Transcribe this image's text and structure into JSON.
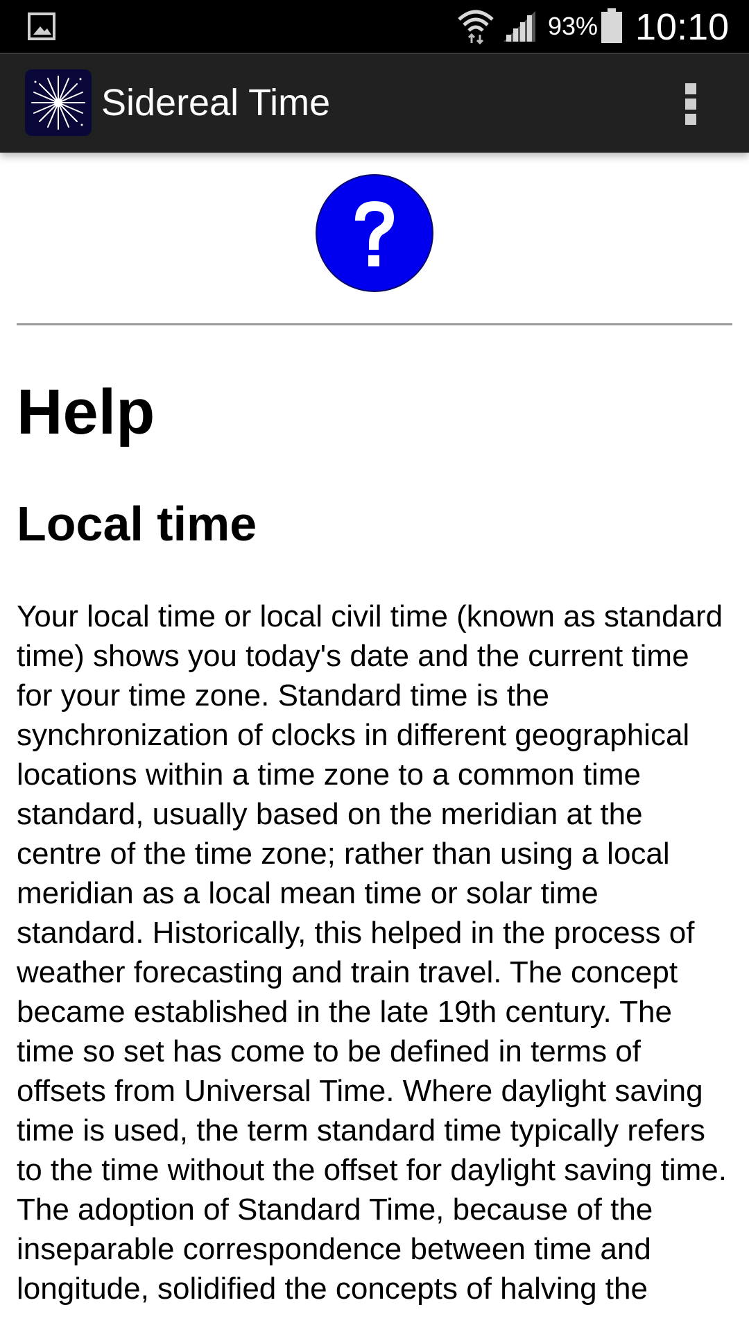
{
  "status_bar": {
    "notification_icon": "gallery-icon",
    "wifi_icon": "wifi-icon",
    "signal_icon": "signal-icon",
    "battery_percent": "93%",
    "battery_icon": "battery-icon",
    "time": "10:10"
  },
  "action_bar": {
    "app_icon": "starburst-app-icon",
    "title": "Sidereal Time",
    "menu_icon": "overflow-menu-icon"
  },
  "content": {
    "badge_icon": "help-question-icon",
    "page_title": "Help",
    "section_title": "Local time",
    "paragraph": "Your local time or local civil time (known as standard time) shows you today's date and the current time for your time zone. Standard time is the synchronization of clocks in different geographical locations within a time zone to a common time standard, usually based on the meridian at the centre of the time zone; rather than using a local meridian as a local mean time or solar time standard. Historically, this helped in the process of weather forecasting and train travel. The concept became established in the late 19th century. The time so set has come to be defined in terms of offsets from Universal Time. Where daylight saving time is used, the term standard time typically refers to the time without the offset for daylight saving time. The adoption of Standard Time, because of the inseparable correspondence between time and longitude, solidified the concepts of halving the"
  },
  "colors": {
    "status_bar_bg": "#000000",
    "action_bar_bg": "#212121",
    "badge_blue": "#0000ee",
    "page_bg": "#ffffff",
    "divider": "#9a9a9a"
  }
}
